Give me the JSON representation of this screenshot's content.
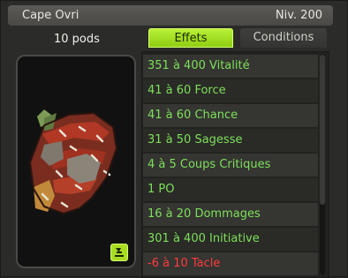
{
  "item": {
    "name": "Cape Ovri",
    "level": "Niv. 200",
    "weight": "10 pods"
  },
  "tabs": [
    {
      "label": "Effets",
      "active": true
    },
    {
      "label": "Conditions",
      "active": false
    }
  ],
  "effects": [
    {
      "text": "351 à 400 Vitalité",
      "type": "positive"
    },
    {
      "text": "41 à 60 Force",
      "type": "positive"
    },
    {
      "text": "41 à 60 Chance",
      "type": "positive"
    },
    {
      "text": "31 à 50 Sagesse",
      "type": "positive"
    },
    {
      "text": "4 à 5 Coups Critiques",
      "type": "positive"
    },
    {
      "text": "1 PO",
      "type": "positive"
    },
    {
      "text": "16 à 20 Dommages",
      "type": "positive"
    },
    {
      "text": "301 à 400 Initiative",
      "type": "positive"
    },
    {
      "text": "-6 à 10 Tacle",
      "type": "negative"
    }
  ],
  "colors": {
    "positive": "#7de05a",
    "negative": "#ff3c3c",
    "active_tab": "#a8e628"
  },
  "icons": {
    "recipe": "recipe-icon",
    "item": "cape-illustration"
  }
}
